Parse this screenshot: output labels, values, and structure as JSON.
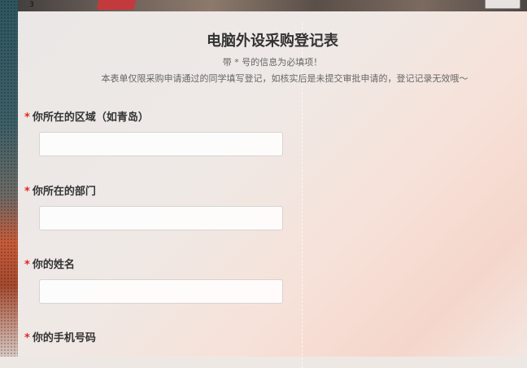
{
  "banner": {
    "number": "3"
  },
  "form": {
    "title": "电脑外设采购登记表",
    "required_hint": "带 * 号的信息为必填项！",
    "notice": "本表单仅限采购申请通过的同学填写登记，如核实后是未提交审批申请的，登记记录无效哦～"
  },
  "questions": [
    {
      "required_mark": "*",
      "label": "你所在的区域（如青岛）",
      "value": ""
    },
    {
      "required_mark": "*",
      "label": "你所在的部门",
      "value": ""
    },
    {
      "required_mark": "*",
      "label": "你的姓名",
      "value": ""
    },
    {
      "required_mark": "*",
      "label": "你的手机号码",
      "value": ""
    }
  ],
  "colors": {
    "accent_required": "#e3261f",
    "title": "#333333"
  }
}
